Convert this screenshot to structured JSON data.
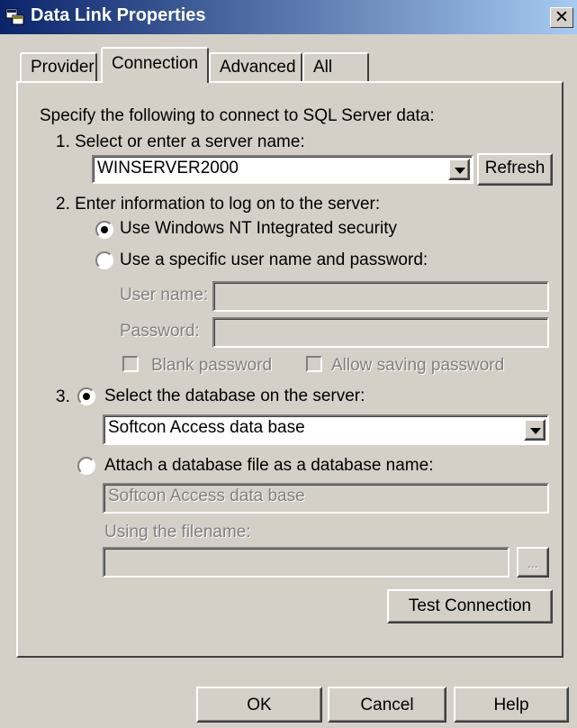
{
  "window": {
    "title": "Data Link Properties",
    "close_glyph": "✕",
    "icon": "data-link-icon"
  },
  "tabs": [
    {
      "label": "Provider",
      "active": false
    },
    {
      "label": "Connection",
      "active": true
    },
    {
      "label": "Advanced",
      "active": false
    },
    {
      "label": "All",
      "active": false
    }
  ],
  "connection": {
    "intro": "Specify the following to connect to SQL Server data:",
    "step1_label": "1. Select or enter a server name:",
    "server_name": "WINSERVER2000",
    "refresh_label": "Refresh",
    "step2_label": "2. Enter information to log on to the server:",
    "radio_nt_security": "Use Windows NT Integrated security",
    "radio_specific_user": "Use a specific user name and password:",
    "username_label": "User name:",
    "username_value": "",
    "password_label": "Password:",
    "password_value": "",
    "blank_password_label": "Blank password",
    "allow_saving_label": "Allow saving password",
    "step3_number": "3.",
    "radio_select_db": "Select the database on the server:",
    "database_name": "Softcon Access data base",
    "radio_attach_db": "Attach a database file as a database name:",
    "attach_db_name": "Softcon Access data base",
    "filename_label": "Using the filename:",
    "filename_value": "",
    "browse_label": "...",
    "test_connection_label": "Test Connection"
  },
  "footer": {
    "ok_label": "OK",
    "cancel_label": "Cancel",
    "help_label": "Help"
  }
}
